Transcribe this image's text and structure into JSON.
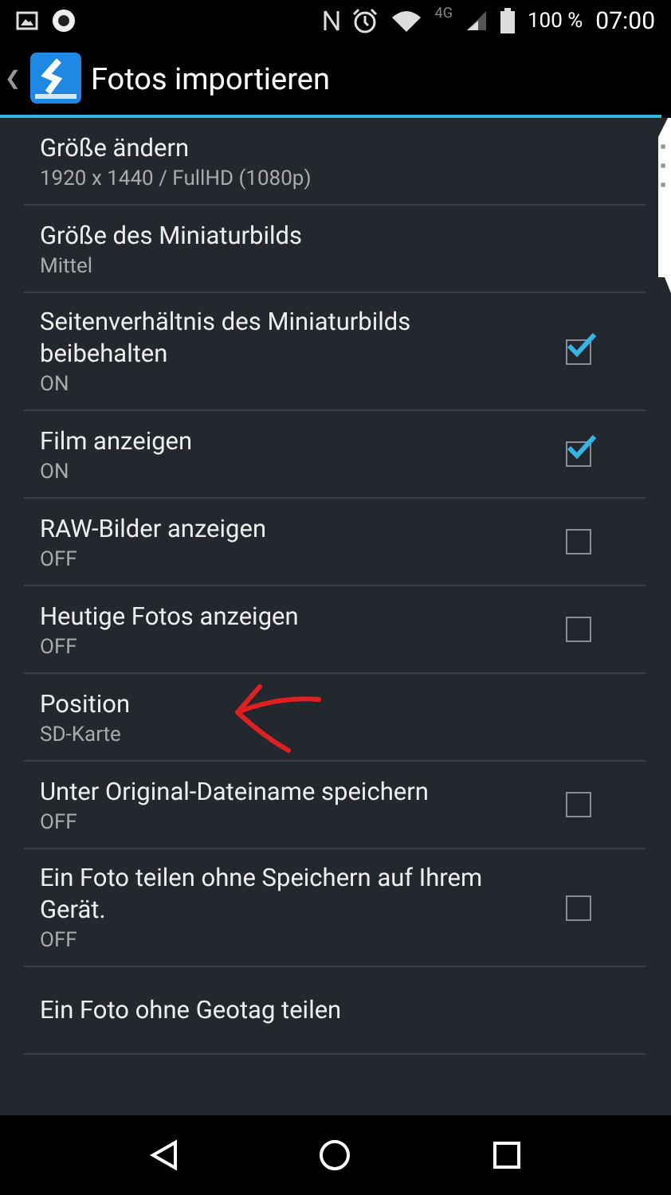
{
  "status_bar": {
    "battery": "100 %",
    "time": "07:00",
    "network": "4G"
  },
  "header": {
    "title": "Fotos importieren",
    "back": "❮"
  },
  "settings": [
    {
      "kind": "value",
      "title": "Größe ändern",
      "value": "1920 x 1440 / FullHD (1080p)"
    },
    {
      "kind": "value",
      "title": "Größe des Miniaturbilds",
      "value": "Mittel"
    },
    {
      "kind": "check",
      "title": "Seitenverhältnis des Miniaturbilds beibehalten",
      "value": "ON",
      "checked": true
    },
    {
      "kind": "check",
      "title": "Film anzeigen",
      "value": "ON",
      "checked": true
    },
    {
      "kind": "check",
      "title": "RAW-Bilder anzeigen",
      "value": "OFF",
      "checked": false
    },
    {
      "kind": "check",
      "title": "Heutige Fotos anzeigen",
      "value": "OFF",
      "checked": false
    },
    {
      "kind": "value",
      "title": "Position",
      "value": "SD-Karte",
      "annotated": true
    },
    {
      "kind": "check",
      "title": "Unter Original-Dateiname speichern",
      "value": "OFF",
      "checked": false
    },
    {
      "kind": "check",
      "title": "Ein Foto teilen ohne Speichern auf Ihrem Gerät.",
      "value": "OFF",
      "checked": false
    },
    {
      "kind": "value",
      "title": "Ein Foto ohne Geotag teilen"
    }
  ]
}
